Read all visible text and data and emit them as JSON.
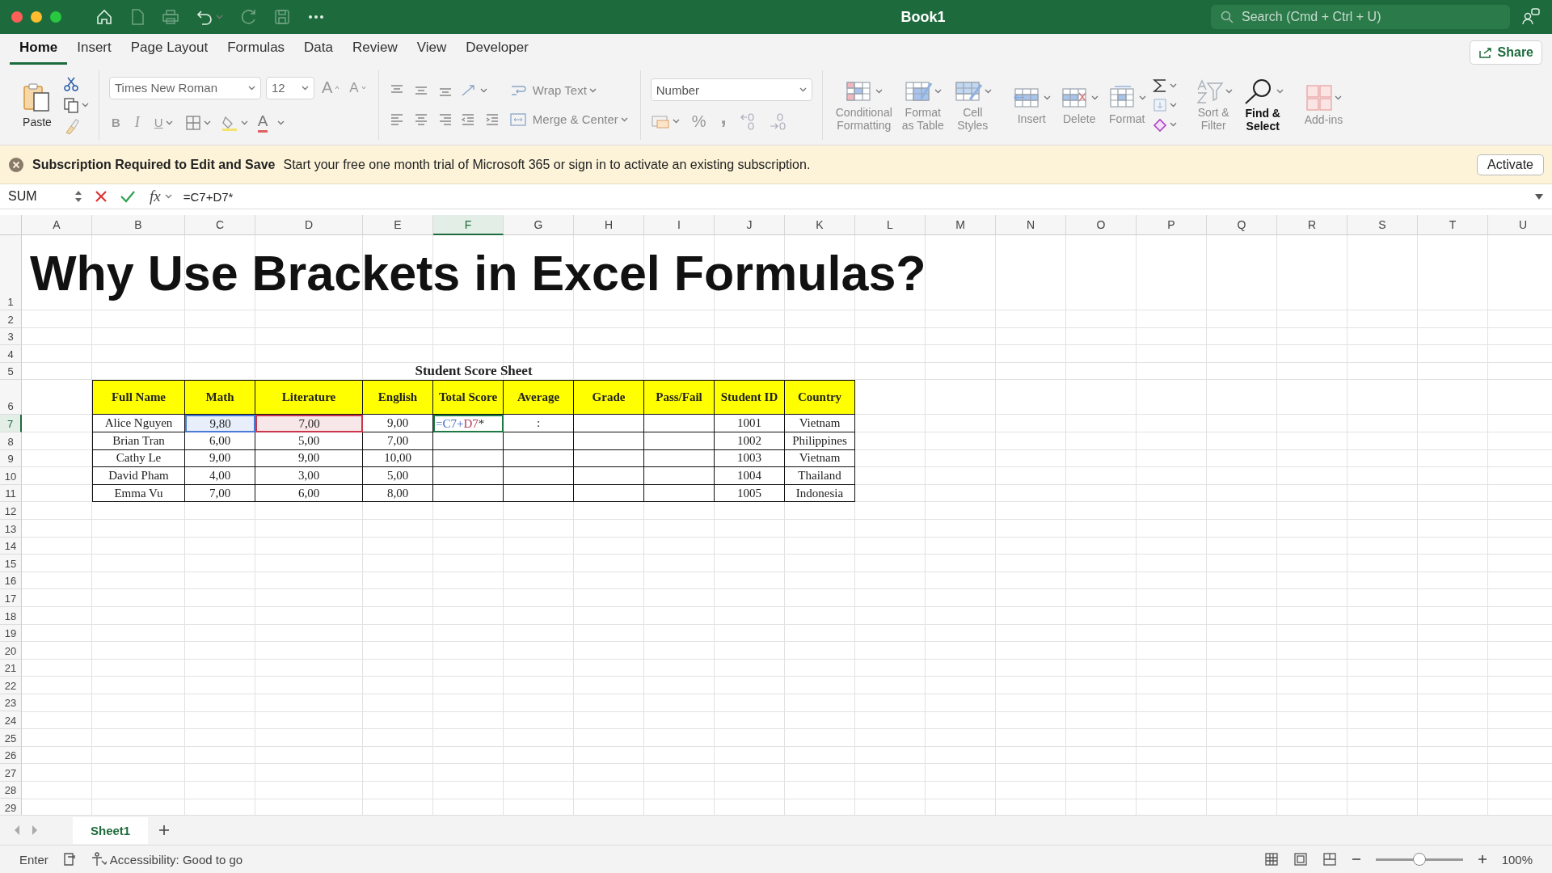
{
  "window": {
    "title": "Book1",
    "search_placeholder": "Search (Cmd + Ctrl + U)"
  },
  "ribbon_tabs": [
    {
      "label": "Home",
      "selected": true
    },
    {
      "label": "Insert",
      "selected": false
    },
    {
      "label": "Page Layout",
      "selected": false
    },
    {
      "label": "Formulas",
      "selected": false
    },
    {
      "label": "Data",
      "selected": false
    },
    {
      "label": "Review",
      "selected": false
    },
    {
      "label": "View",
      "selected": false
    },
    {
      "label": "Developer",
      "selected": false
    }
  ],
  "share_button": "Share",
  "ribbon": {
    "paste": "Paste",
    "font": "Times New Roman",
    "font_size": "12",
    "grow": "A",
    "shrink": "A",
    "style_buttons": [
      "B",
      "I",
      "U"
    ],
    "font_color": "A",
    "wrap_text": "Wrap Text",
    "merge_center": "Merge & Center",
    "number_format": "Number",
    "percent": "%",
    "comma": ",",
    "tools": [
      {
        "kind": "conditional",
        "lines": [
          "Conditional",
          "Formatting"
        ],
        "disabled": true
      },
      {
        "kind": "table",
        "lines": [
          "Format",
          "as Table"
        ],
        "disabled": true
      },
      {
        "kind": "styles",
        "lines": [
          "Cell",
          "Styles"
        ],
        "disabled": true
      },
      {
        "kind": "insert",
        "lines": [
          "Insert"
        ],
        "disabled": true
      },
      {
        "kind": "delete",
        "lines": [
          "Delete"
        ],
        "disabled": true
      },
      {
        "kind": "format",
        "lines": [
          "Format"
        ],
        "disabled": true
      },
      {
        "kind": "sum",
        "disabled": false
      },
      {
        "kind": "sort",
        "lines": [
          "Sort &",
          "Filter"
        ],
        "disabled": true
      },
      {
        "kind": "find",
        "lines": [
          "Find &",
          "Select"
        ],
        "disabled": false
      },
      {
        "kind": "addins",
        "lines": [
          "Add-ins"
        ],
        "disabled": true
      }
    ]
  },
  "notice": {
    "title": "Subscription Required to Edit and Save",
    "message": "Start your free one month trial of Microsoft 365 or sign in to activate an existing subscription.",
    "button": "Activate"
  },
  "formula_bar": {
    "name_box": "SUM",
    "fx": "fx",
    "formula": "=C7+D7*"
  },
  "sheet": {
    "columns": [
      {
        "label": "A",
        "selected": false
      },
      {
        "label": "B",
        "selected": false
      },
      {
        "label": "C",
        "selected": false
      },
      {
        "label": "D",
        "selected": false
      },
      {
        "label": "E",
        "selected": false
      },
      {
        "label": "F",
        "selected": true
      },
      {
        "label": "G",
        "selected": false
      },
      {
        "label": "H",
        "selected": false
      },
      {
        "label": "I",
        "selected": false
      },
      {
        "label": "J",
        "selected": false
      },
      {
        "label": "K",
        "selected": false
      },
      {
        "label": "L",
        "selected": false
      },
      {
        "label": "M",
        "selected": false
      },
      {
        "label": "N",
        "selected": false
      },
      {
        "label": "O",
        "selected": false
      },
      {
        "label": "P",
        "selected": false
      },
      {
        "label": "Q",
        "selected": false
      },
      {
        "label": "R",
        "selected": false
      },
      {
        "label": "S",
        "selected": false
      },
      {
        "label": "T",
        "selected": false
      },
      {
        "label": "U",
        "selected": false
      }
    ],
    "rows": [
      {
        "label": "1",
        "selected": false
      },
      {
        "label": "2",
        "selected": false
      },
      {
        "label": "3",
        "selected": false
      },
      {
        "label": "4",
        "selected": false
      },
      {
        "label": "5",
        "selected": false
      },
      {
        "label": "6",
        "selected": false
      },
      {
        "label": "7",
        "selected": true
      },
      {
        "label": "8",
        "selected": false
      },
      {
        "label": "9",
        "selected": false
      },
      {
        "label": "10",
        "selected": false
      },
      {
        "label": "11",
        "selected": false
      },
      {
        "label": "12",
        "selected": false
      },
      {
        "label": "13",
        "selected": false
      },
      {
        "label": "14",
        "selected": false
      },
      {
        "label": "15",
        "selected": false
      },
      {
        "label": "16",
        "selected": false
      },
      {
        "label": "17",
        "selected": false
      },
      {
        "label": "18",
        "selected": false
      },
      {
        "label": "19",
        "selected": false
      },
      {
        "label": "20",
        "selected": false
      },
      {
        "label": "21",
        "selected": false
      },
      {
        "label": "22",
        "selected": false
      },
      {
        "label": "23",
        "selected": false
      },
      {
        "label": "24",
        "selected": false
      },
      {
        "label": "25",
        "selected": false
      },
      {
        "label": "26",
        "selected": false
      },
      {
        "label": "27",
        "selected": false
      },
      {
        "label": "28",
        "selected": false
      },
      {
        "label": "29",
        "selected": false
      }
    ],
    "title": "Why Use Brackets in Excel Formulas?",
    "table_title": "Student Score Sheet",
    "table_headers": [
      "Full Name",
      "Math",
      "Literature",
      "English",
      "Total Score",
      "Average",
      "Grade",
      "Pass/Fail",
      "Student ID",
      "Country"
    ],
    "table_rows": [
      {
        "full_name": "Alice Nguyen",
        "math": "9,80",
        "literature": "7,00",
        "english": "9,00",
        "total_score_formula": [
          {
            "text": "=C7+",
            "color": "#3f6cc4"
          },
          {
            "text": "D7",
            "color": "#b03a55"
          },
          {
            "text": "*"
          }
        ],
        "average": ":",
        "student_id": "1001",
        "country": "Vietnam",
        "reference_marks": {
          "math": {
            "color": "#4a7bd6"
          },
          "literature": {
            "color": "#c8374a"
          }
        }
      },
      {
        "full_name": "Brian Tran",
        "math": "6,00",
        "literature": "5,00",
        "english": "7,00",
        "student_id": "1002",
        "country": "Philippines"
      },
      {
        "full_name": "Cathy Le",
        "math": "9,00",
        "literature": "9,00",
        "english": "10,00",
        "student_id": "1003",
        "country": "Vietnam"
      },
      {
        "full_name": "David Pham",
        "math": "4,00",
        "literature": "3,00",
        "english": "5,00",
        "student_id": "1004",
        "country": "Thailand"
      },
      {
        "full_name": "Emma Vu",
        "math": "7,00",
        "literature": "6,00",
        "english": "8,00",
        "student_id": "1005",
        "country": "Indonesia"
      }
    ]
  },
  "sheet_tabs": [
    {
      "label": "Sheet1",
      "selected": true
    }
  ],
  "status_bar": {
    "mode": "Enter",
    "accessibility": "Accessibility: Good to go",
    "zoom": "100%",
    "zoom_slider": {
      "level": 0.5
    }
  }
}
